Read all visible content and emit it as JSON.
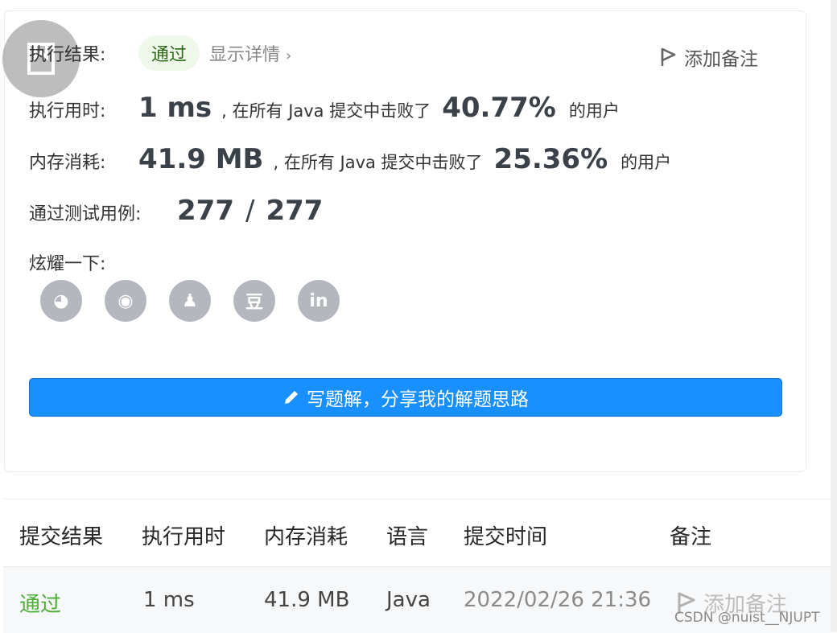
{
  "summary": {
    "result_label": "执行结果:",
    "result_status": "通过",
    "show_details": "显示详情",
    "add_note": "添加备注",
    "runtime_label": "执行用时:",
    "runtime_value": "1 ms",
    "runtime_text": ", 在所有 Java 提交中击败了",
    "runtime_percent": "40.77%",
    "runtime_suffix": "的用户",
    "memory_label": "内存消耗:",
    "memory_value": "41.9 MB",
    "memory_text": ", 在所有 Java 提交中击败了",
    "memory_percent": "25.36%",
    "memory_suffix": "的用户",
    "tests_label": "通过测试用例:",
    "tests_passed": "277",
    "tests_sep": "/",
    "tests_total": "277",
    "share_label": "炫耀一下:",
    "share_icons": [
      {
        "name": "wechat-icon",
        "glyph": "◕"
      },
      {
        "name": "weibo-icon",
        "glyph": "◉"
      },
      {
        "name": "qq-icon",
        "glyph": "♟"
      },
      {
        "name": "douban-icon",
        "glyph": "豆"
      },
      {
        "name": "linkedin-icon",
        "glyph": "in"
      }
    ],
    "write_solution": "写题解，分享我的解题思路"
  },
  "table": {
    "headers": [
      "提交结果",
      "执行用时",
      "内存消耗",
      "语言",
      "提交时间",
      "备注"
    ],
    "rows": [
      {
        "result": "通过",
        "runtime": "1 ms",
        "memory": "41.9 MB",
        "language": "Java",
        "time": "2022/02/26 21:36",
        "note": "添加备注"
      }
    ]
  },
  "watermark": "CSDN @nuist__NJUPT",
  "colors": {
    "accent": "#1890ff",
    "success": "#4caf35",
    "success_bg": "#f0f8ec",
    "icon_gray": "#b4b8be"
  }
}
